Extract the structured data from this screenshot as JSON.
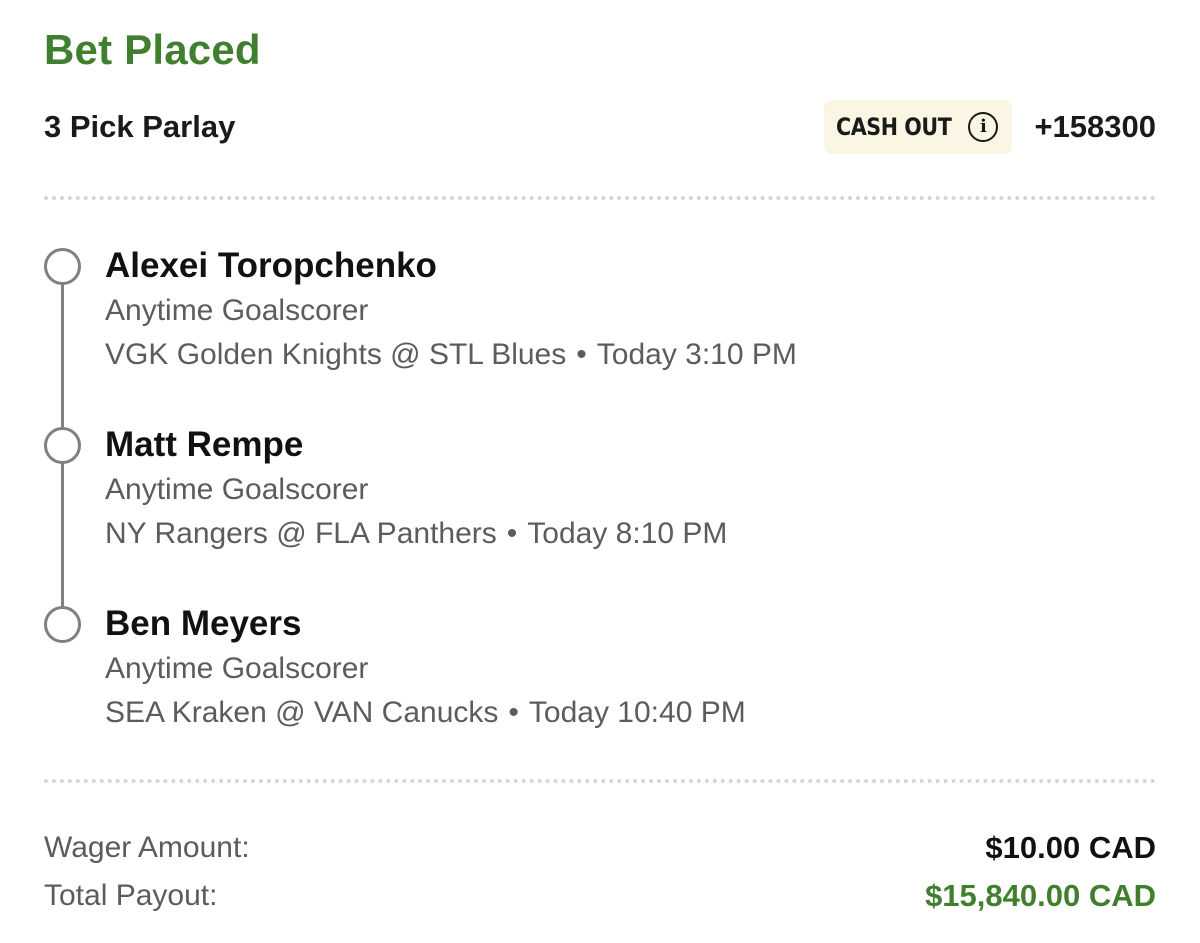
{
  "header": {
    "title": "Bet Placed",
    "bet_type": "3 Pick Parlay",
    "cash_out_label": "CASH OUT",
    "info_icon": "info-icon",
    "odds": "+158300"
  },
  "legs": [
    {
      "player": "Alexei Toropchenko",
      "market": "Anytime Goalscorer",
      "matchup": "VGK Golden Knights @ STL Blues",
      "separator": "•",
      "time": "Today 3:10 PM"
    },
    {
      "player": "Matt Rempe",
      "market": "Anytime Goalscorer",
      "matchup": "NY Rangers @ FLA Panthers",
      "separator": "•",
      "time": "Today 8:10 PM"
    },
    {
      "player": "Ben Meyers",
      "market": "Anytime Goalscorer",
      "matchup": "SEA Kraken @ VAN Canucks",
      "separator": "•",
      "time": "Today 10:40 PM"
    }
  ],
  "summary": {
    "wager_label": "Wager Amount:",
    "wager_value": "$10.00 CAD",
    "payout_label": "Total Payout:",
    "payout_value": "$15,840.00 CAD"
  },
  "colors": {
    "accent_green": "#3f7f2d",
    "cash_out_bg": "#fbf6e3",
    "timeline_gray": "#808080"
  }
}
